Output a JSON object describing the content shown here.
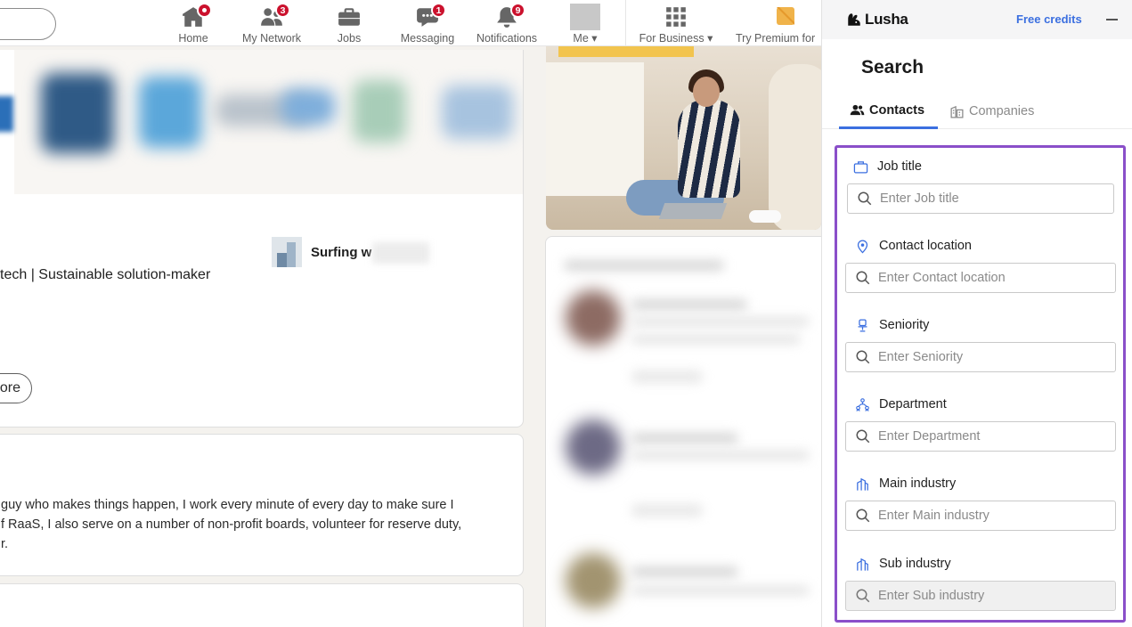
{
  "nav": {
    "items": [
      {
        "label": "Home",
        "badge": ""
      },
      {
        "label": "My Network",
        "badge": "3"
      },
      {
        "label": "Jobs",
        "badge": ""
      },
      {
        "label": "Messaging",
        "badge": "1"
      },
      {
        "label": "Notifications",
        "badge": "9"
      },
      {
        "label": "Me"
      },
      {
        "label": "For Business"
      },
      {
        "label": "Try Premium for"
      }
    ]
  },
  "feed": {
    "headline_fragment": "tech | Sustainable solution-maker",
    "company_name": "Surfing w",
    "more_button": "ore",
    "about_lines": [
      "guy who makes things happen, I work every minute of every day to make sure I",
      "f RaaS, I also serve on a number of non-profit boards, volunteer for reserve duty,",
      "r."
    ]
  },
  "lusha": {
    "brand": "Lusha",
    "free_credits": "Free credits",
    "title": "Search",
    "tabs": {
      "contacts": "Contacts",
      "companies": "Companies"
    },
    "filters": [
      {
        "label": "Job title",
        "placeholder": "Enter Job title",
        "icon": "briefcase-icon"
      },
      {
        "label": "Contact location",
        "placeholder": "Enter Contact location",
        "icon": "location-pin-icon"
      },
      {
        "label": "Seniority",
        "placeholder": "Enter Seniority",
        "icon": "chair-icon"
      },
      {
        "label": "Department",
        "placeholder": "Enter Department",
        "icon": "org-chart-icon"
      },
      {
        "label": "Main industry",
        "placeholder": "Enter Main industry",
        "icon": "industry-icon"
      },
      {
        "label": "Sub industry",
        "placeholder": "Enter Sub industry",
        "icon": "industry-icon"
      }
    ]
  },
  "colors": {
    "accent_blue": "#3b6fe0",
    "filter_border_purple": "#8a4fc9",
    "linkedin_badge_red": "#cb112d"
  }
}
